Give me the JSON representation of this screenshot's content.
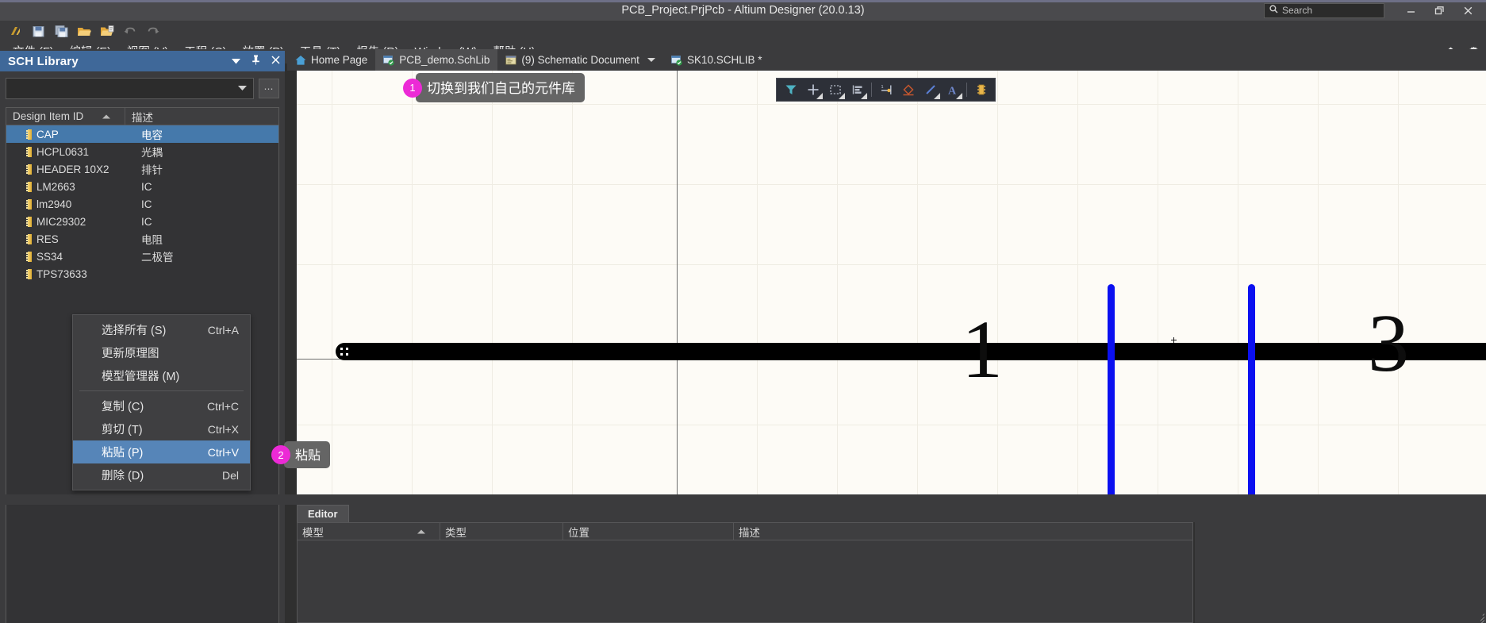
{
  "window": {
    "title": "PCB_Project.PrjPcb - Altium Designer (20.0.13)",
    "search_placeholder": "Search",
    "search_icon": "search-icon",
    "minimize_label": "—",
    "restore_label": "❐",
    "close_label": "✕"
  },
  "quick_toolbar": {
    "items": [
      {
        "name": "altium-logo-icon",
        "label": "A"
      },
      {
        "name": "save-icon",
        "label": "Save"
      },
      {
        "name": "save-all-icon",
        "label": "Save All"
      },
      {
        "name": "open-folder-icon",
        "label": "Open"
      },
      {
        "name": "open-project-icon",
        "label": "Open Project"
      },
      {
        "name": "undo-icon",
        "label": "Undo"
      },
      {
        "name": "redo-icon",
        "label": "Redo"
      }
    ]
  },
  "menubar": {
    "items": [
      {
        "text": "文件 (F)",
        "label": "文件",
        "key": "F"
      },
      {
        "text": "编辑 (E)",
        "label": "编辑",
        "key": "E"
      },
      {
        "text": "视图 (V)",
        "label": "视图",
        "key": "V"
      },
      {
        "text": "工程 (C)",
        "label": "工程",
        "key": "C"
      },
      {
        "text": "放置 (P)",
        "label": "放置",
        "key": "P"
      },
      {
        "text": "工具 (T)",
        "label": "工具",
        "key": "T"
      },
      {
        "text": "报告 (R)",
        "label": "报告",
        "key": "R"
      },
      {
        "text": "Window (W)",
        "label": "Window",
        "key": "W"
      },
      {
        "text": "帮助 (H)",
        "label": "帮助",
        "key": "H"
      }
    ],
    "right_icons": [
      {
        "name": "home-icon",
        "glyph": "⌂"
      },
      {
        "name": "gear-icon",
        "glyph": "⚙"
      }
    ]
  },
  "sch_library_panel": {
    "title": "SCH Library",
    "header_buttons": [
      {
        "name": "panel-dropdown-icon",
        "glyph": "▾"
      },
      {
        "name": "pin-icon",
        "glyph": "‡"
      },
      {
        "name": "close-icon",
        "glyph": "✕"
      }
    ],
    "filter_value": "",
    "ellipsis_label": "⋯",
    "columns": [
      {
        "key": "id",
        "label": "Design Item ID",
        "sorted": true
      },
      {
        "key": "desc",
        "label": "描述"
      }
    ],
    "rows": [
      {
        "id": "CAP",
        "desc": "电容",
        "selected": true
      },
      {
        "id": "HCPL0631",
        "desc": "光耦",
        "selected": false
      },
      {
        "id": "HEADER 10X2",
        "desc": "排针",
        "selected": false
      },
      {
        "id": "LM2663",
        "desc": "IC",
        "selected": false
      },
      {
        "id": "lm2940",
        "desc": "IC",
        "selected": false
      },
      {
        "id": "MIC29302",
        "desc": "IC",
        "selected": false
      },
      {
        "id": "RES",
        "desc": "电阻",
        "selected": false
      },
      {
        "id": "SS34",
        "desc": "二极管",
        "selected": false
      },
      {
        "id": "TPS73633",
        "desc": "",
        "selected": false
      }
    ]
  },
  "context_menu": {
    "items": [
      {
        "label": "选择所有 (S)",
        "shortcut": "Ctrl+A",
        "selected": false,
        "sep_after": false
      },
      {
        "label": "更新原理图",
        "shortcut": "",
        "selected": false,
        "sep_after": false
      },
      {
        "label": "模型管理器 (M)",
        "shortcut": "",
        "selected": false,
        "sep_after": true
      },
      {
        "label": "复制 (C)",
        "shortcut": "Ctrl+C",
        "selected": false,
        "sep_after": false
      },
      {
        "label": "剪切 (T)",
        "shortcut": "Ctrl+X",
        "selected": false,
        "sep_after": false
      },
      {
        "label": "粘贴 (P)",
        "shortcut": "Ctrl+V",
        "selected": true,
        "sep_after": false
      },
      {
        "label": "删除 (D)",
        "shortcut": "Del",
        "selected": false,
        "sep_after": false
      }
    ]
  },
  "document_tabs": {
    "tabs": [
      {
        "label": "Home Page",
        "icon": "home-icon",
        "active": false,
        "dropdown": false,
        "modified": false
      },
      {
        "label": "PCB_demo.SchLib",
        "icon": "schlib-icon",
        "active": true,
        "dropdown": false,
        "modified": false
      },
      {
        "label": "(9) Schematic Document",
        "icon": "schematic-icon",
        "active": false,
        "dropdown": true,
        "modified": false
      },
      {
        "label": "SK10.SCHLIB *",
        "icon": "schlib-icon",
        "active": false,
        "dropdown": false,
        "modified": true
      }
    ]
  },
  "canvas_toolbar": {
    "buttons": [
      {
        "name": "filter-icon",
        "dropdown": false
      },
      {
        "name": "crosshair-icon",
        "dropdown": true
      },
      {
        "name": "rectangle-select-icon",
        "dropdown": true
      },
      {
        "name": "align-icon",
        "dropdown": true
      },
      {
        "name": "place-pin-icon",
        "dropdown": false
      },
      {
        "name": "place-polygon-icon",
        "dropdown": false
      },
      {
        "name": "place-line-icon",
        "dropdown": true
      },
      {
        "name": "place-text-icon",
        "dropdown": true
      },
      {
        "name": "place-part-icon",
        "dropdown": false
      }
    ]
  },
  "canvas": {
    "symbol_name": "CAP",
    "pin_labels": [
      "1",
      "3"
    ],
    "selection_color": "#000000",
    "plate_color": "#0b10f0",
    "background_color": "#fdfbf6"
  },
  "editor_panel": {
    "tab_label": "Editor",
    "columns": [
      {
        "key": "model",
        "label": "模型",
        "sorted": true
      },
      {
        "key": "type",
        "label": "类型",
        "sorted": false
      },
      {
        "key": "location",
        "label": "位置",
        "sorted": false
      },
      {
        "key": "desc",
        "label": "描述",
        "sorted": false
      }
    ],
    "rows": []
  },
  "annotations": [
    {
      "number": "1",
      "text": "切换到我们自己的元件库"
    },
    {
      "number": "2",
      "text": "粘贴"
    }
  ],
  "colors": {
    "accent_panel_header": "#3f6899",
    "selection_blue": "#4579ab",
    "menu_highlight": "#5685b8",
    "callout_pink": "#ec2ad6",
    "chrome_dark": "#3b3b3d",
    "titlebar": "#4a4a4d"
  }
}
